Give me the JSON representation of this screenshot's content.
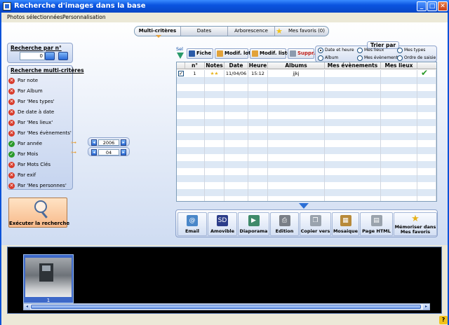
{
  "window": {
    "title": "Recherche d'images dans la base",
    "min_label": "_",
    "max_label": "□",
    "close_label": "✕"
  },
  "menu": {
    "items": [
      "Photos sélectionnées",
      "Personnalisation"
    ]
  },
  "tabs": [
    {
      "label": "Multi-critères",
      "active": true
    },
    {
      "label": "Dates",
      "active": false
    },
    {
      "label": "Arborescence",
      "active": false
    },
    {
      "label": "Mes favoris (0)",
      "active": false
    }
  ],
  "search_by_number": {
    "title": "Recherche par n°",
    "value": "0"
  },
  "multi_criteria": {
    "title": "Recherche multi-critères",
    "criteria": [
      {
        "label": "Par note",
        "active": false
      },
      {
        "label": "Par Album",
        "active": false
      },
      {
        "label": "Par 'Mes types'",
        "active": false
      },
      {
        "label": "De date à date",
        "active": false
      },
      {
        "label": "Par 'Mes lieux'",
        "active": false
      },
      {
        "label": "Par 'Mes évènements'",
        "active": false
      },
      {
        "label": "Par année",
        "active": true
      },
      {
        "label": "Par Mois",
        "active": true
      },
      {
        "label": "Par Mots Clés",
        "active": false
      },
      {
        "label": "Par exif",
        "active": false
      },
      {
        "label": "Par 'Mes personnes'",
        "active": false
      }
    ],
    "year_value": "2006",
    "month_value": "04",
    "execute_label": "Exécuter la recherche"
  },
  "toolbar": {
    "sel_label": "Sel",
    "fiche_label": "Fiche",
    "modif_lot_label": "Modif. lot",
    "modif_liste_label": "Modif. liste",
    "suppr_label": "Suppr."
  },
  "sort": {
    "title": "Trier par",
    "options": [
      {
        "label": "Date et heure",
        "selected": true
      },
      {
        "label": "Mes lieux",
        "selected": false
      },
      {
        "label": "Mes types",
        "selected": false
      },
      {
        "label": "Album",
        "selected": false
      },
      {
        "label": "Mes évènements",
        "selected": false
      },
      {
        "label": "Ordre de saisie",
        "selected": false
      }
    ]
  },
  "table": {
    "columns": [
      "n°",
      "Notes",
      "Date",
      "Heure",
      "Albums",
      "Mes évènements",
      "Mes lieux"
    ],
    "rows": [
      {
        "n": "1",
        "notes": "★★",
        "date": "11/04/06",
        "heure": "15:12",
        "albums": "jjkj",
        "evenements": "",
        "lieux": "",
        "checked": true
      }
    ]
  },
  "actions": [
    {
      "label": "Email",
      "icon": "email-icon",
      "glyph": "@",
      "color": "#4a87c9"
    },
    {
      "label": "Amovible",
      "icon": "sd-card-icon",
      "glyph": "SD",
      "color": "#2c3d8a"
    },
    {
      "label": "Diaporama",
      "icon": "slideshow-icon",
      "glyph": "▶",
      "color": "#3f8a6a"
    },
    {
      "label": "Edition",
      "icon": "printer-icon",
      "glyph": "⎙",
      "color": "#7a7f87"
    },
    {
      "label": "Copier vers",
      "icon": "copy-icon",
      "glyph": "❐",
      "color": "#9aa3ad"
    },
    {
      "label": "Mosaique",
      "icon": "mosaic-icon",
      "glyph": "▦",
      "color": "#b88a3a"
    },
    {
      "label": "Page HTML",
      "icon": "html-page-icon",
      "glyph": "▤",
      "color": "#9aa3ad"
    },
    {
      "label": "Mémoriser dans Mes favoris",
      "icon": "favorite-star-icon",
      "glyph": "★",
      "color": "#e7b21a"
    }
  ],
  "filmstrip": {
    "items": [
      {
        "number": "1"
      }
    ]
  },
  "colors": {
    "title_blue": "#0a54e0",
    "no_red": "#d83a2a",
    "yes_green": "#2a9a2a",
    "star_yellow": "#f2c21a"
  }
}
